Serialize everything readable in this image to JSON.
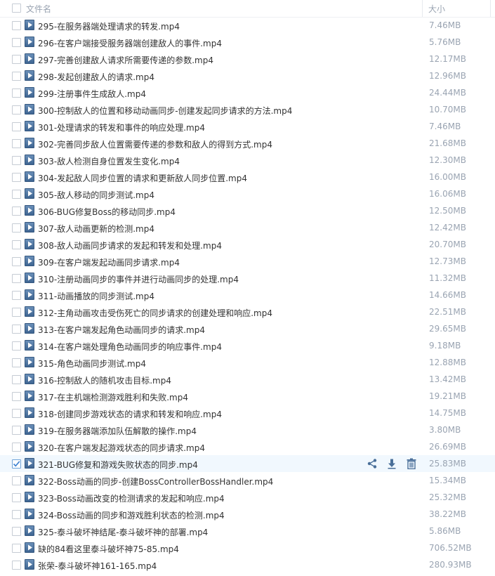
{
  "header": {
    "name_label": "文件名",
    "size_label": "大小"
  },
  "files": [
    {
      "name": "295-在服务器端处理请求的转发.mp4",
      "size": "7.46MB"
    },
    {
      "name": "296-在客户端接受服务器端创建敌人的事件.mp4",
      "size": "5.76MB"
    },
    {
      "name": "297-完善创建敌人请求所需要传递的参数.mp4",
      "size": "12.17MB"
    },
    {
      "name": "298-发起创建敌人的请求.mp4",
      "size": "12.96MB"
    },
    {
      "name": "299-注册事件生成敌人.mp4",
      "size": "24.44MB"
    },
    {
      "name": "300-控制敌人的位置和移动动画同步-创建发起同步请求的方法.mp4",
      "size": "10.70MB"
    },
    {
      "name": "301-处理请求的转发和事件的响应处理.mp4",
      "size": "7.46MB"
    },
    {
      "name": "302-完善同步敌人位置需要传递的参数和敌人的得到方式.mp4",
      "size": "21.68MB"
    },
    {
      "name": "303-敌人检测自身位置发生变化.mp4",
      "size": "12.30MB"
    },
    {
      "name": "304-发起敌人同步位置的请求和更新敌人同步位置.mp4",
      "size": "16.00MB"
    },
    {
      "name": "305-敌人移动的同步测试.mp4",
      "size": "16.06MB"
    },
    {
      "name": "306-BUG修复Boss的移动同步.mp4",
      "size": "12.50MB"
    },
    {
      "name": "307-敌人动画更新的检测.mp4",
      "size": "12.42MB"
    },
    {
      "name": "308-敌人动画同步请求的发起和转发和处理.mp4",
      "size": "20.70MB"
    },
    {
      "name": "309-在客户端发起动画同步请求.mp4",
      "size": "12.73MB"
    },
    {
      "name": "310-注册动画同步的事件并进行动画同步的处理.mp4",
      "size": "11.32MB"
    },
    {
      "name": "311-动画播放的同步测试.mp4",
      "size": "14.66MB"
    },
    {
      "name": "312-主角动画攻击受伤死亡的同步请求的创建处理和响应.mp4",
      "size": "22.51MB"
    },
    {
      "name": "313-在客户端发起角色动画同步的请求.mp4",
      "size": "29.65MB"
    },
    {
      "name": "314-在客户端处理角色动画同步的响应事件.mp4",
      "size": "9.18MB"
    },
    {
      "name": "315-角色动画同步测试.mp4",
      "size": "12.88MB"
    },
    {
      "name": "316-控制敌人的随机攻击目标.mp4",
      "size": "13.42MB"
    },
    {
      "name": "317-在主机端检测游戏胜利和失败.mp4",
      "size": "19.21MB"
    },
    {
      "name": "318-创建同步游戏状态的请求和转发和响应.mp4",
      "size": "14.75MB"
    },
    {
      "name": "319-在服务器端添加队伍解散的操作.mp4",
      "size": "3.80MB"
    },
    {
      "name": "320-在客户端发起游戏状态的同步请求.mp4",
      "size": "26.69MB"
    },
    {
      "name": "321-BUG修复和游戏失败状态的同步.mp4",
      "size": "25.83MB",
      "selected": true
    },
    {
      "name": "322-Boss动画的同步-创建BossControllerBossHandler.mp4",
      "size": "15.34MB"
    },
    {
      "name": "323-Boss动画改变的检测请求的发起和响应.mp4",
      "size": "25.32MB"
    },
    {
      "name": "324-Boss动画的同步和游戏胜利状态的检测.mp4",
      "size": "38.22MB"
    },
    {
      "name": "325-泰斗破坏神结尾-泰斗破坏神的部署.mp4",
      "size": "5.86MB"
    },
    {
      "name": "缺的84看这里泰斗破坏神75-85.mp4",
      "size": "706.52MB"
    },
    {
      "name": "张荣-泰斗破坏神161-165.mp4",
      "size": "280.93MB"
    }
  ],
  "row_actions": [
    "share-icon",
    "download-icon",
    "delete-icon"
  ],
  "colors": {
    "selected_row": "#f1f8fe",
    "icon": "#4a6f99",
    "size_text": "#9aa4b2"
  }
}
